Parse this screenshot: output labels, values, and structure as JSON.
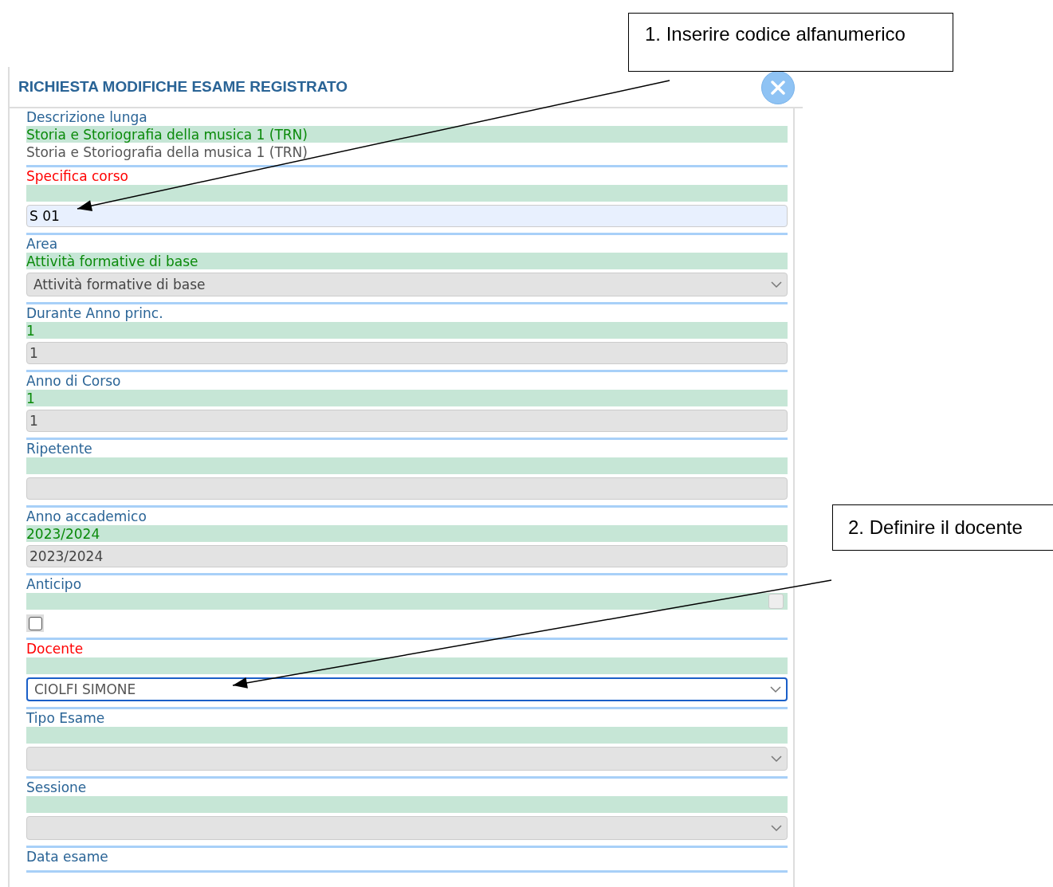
{
  "dialog": {
    "title": "RICHIESTA MODIFICHE ESAME REGISTRATO"
  },
  "fields": [
    {
      "label": "Descrizione lunga",
      "required": false,
      "current": "Storia e Storiografia della musica 1 (TRN)",
      "control": {
        "kind": "text",
        "value": "Storia e Storiografia della musica 1 (TRN)"
      }
    },
    {
      "label": "Specifica corso",
      "required": true,
      "control": {
        "kind": "input",
        "value": "S 01",
        "disabled": false,
        "focused": false
      }
    },
    {
      "label": "Area",
      "required": false,
      "current": "Attività formative di base",
      "control": {
        "kind": "select",
        "value": "Attività formative di base",
        "disabled": true,
        "focused": false
      }
    },
    {
      "label": "Durante Anno princ.",
      "required": false,
      "current": "1",
      "control": {
        "kind": "input",
        "value": "1",
        "disabled": true,
        "focused": false
      }
    },
    {
      "label": "Anno di Corso",
      "required": false,
      "current": "1",
      "control": {
        "kind": "input",
        "value": "1",
        "disabled": true,
        "focused": false
      }
    },
    {
      "label": "Ripetente",
      "required": false,
      "control": {
        "kind": "input",
        "disabled": true,
        "focused": false
      }
    },
    {
      "label": "Anno accademico",
      "required": false,
      "current": "2023/2024",
      "control": {
        "kind": "input",
        "value": "2023/2024",
        "disabled": true,
        "focused": false
      }
    },
    {
      "label": "Anticipo",
      "required": false,
      "current_checked": false,
      "control": {
        "kind": "checkbox",
        "checked": false
      }
    },
    {
      "label": "Docente",
      "required": true,
      "control": {
        "kind": "select",
        "value": "CIOLFI SIMONE",
        "disabled": false,
        "focused": true
      }
    },
    {
      "label": "Tipo Esame",
      "required": false,
      "control": {
        "kind": "select",
        "disabled": true,
        "focused": false
      }
    },
    {
      "label": "Sessione",
      "required": false,
      "control": {
        "kind": "select",
        "disabled": true,
        "focused": false
      }
    },
    {
      "label": "Data esame",
      "required": false
    }
  ],
  "annotations": [
    {
      "text": "1. Inserire codice alfanumerico"
    },
    {
      "text": "2. Definire il docente"
    }
  ]
}
